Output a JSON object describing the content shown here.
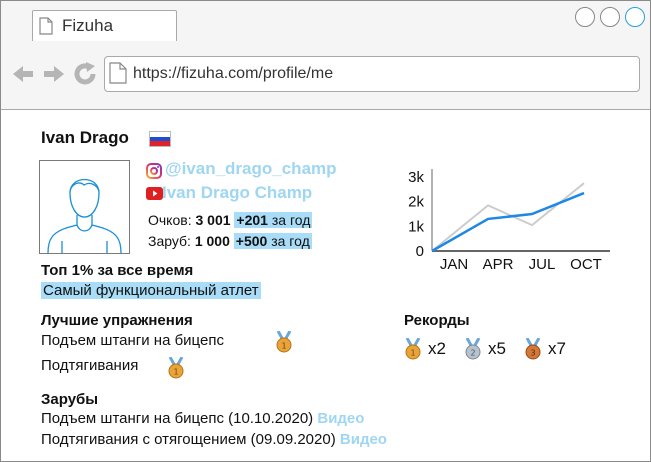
{
  "browser": {
    "tab_title": "Fizuha",
    "url": "https://fizuha.com/profile/me"
  },
  "profile": {
    "name": "Ivan Drago",
    "country_flag": "russia-flag-icon",
    "instagram": "@ivan_drago_champ",
    "youtube": "Ivan Drago Champ",
    "points_label": "Очков:",
    "points_value": "3 001",
    "points_delta": "+201",
    "points_period": "за год",
    "lifts_label": "Заруб:",
    "lifts_value": "1 000",
    "lifts_delta": "+500",
    "lifts_period": "за год",
    "rank_title": "Топ 1% за все время",
    "rank_badge": "Самый функциональный атлет"
  },
  "best_exercises": {
    "title": "Лучшие упражнения",
    "items": [
      {
        "label": "Подъем штанги на бицепс",
        "medal": "gold"
      },
      {
        "label": "Подтягивания",
        "medal": "gold"
      }
    ]
  },
  "records": {
    "title": "Рекорды",
    "items": [
      {
        "medal": "gold",
        "count": "x2"
      },
      {
        "medal": "silver",
        "count": "x5"
      },
      {
        "medal": "bronze",
        "count": "x7"
      }
    ]
  },
  "lifts_log": {
    "title": "Зарубы",
    "items": [
      {
        "text": "Подъем штанги на бицепс (10.10.2020)",
        "link": "Видео"
      },
      {
        "text": "Подтягивания с отягощением (09.09.2020)",
        "link": "Видео"
      }
    ]
  },
  "colors": {
    "accent": "#1e88e5",
    "highlight": "#a8dcf7",
    "link": "#9fd6f2",
    "gold": "#e8a33a",
    "silver": "#b8c2cc",
    "bronze": "#d2783a"
  },
  "chart_data": {
    "type": "line",
    "categories": [
      "JAN",
      "APR",
      "JUL",
      "OCT"
    ],
    "ytick_labels": [
      "0",
      "1k",
      "2k",
      "3k"
    ],
    "ylim": [
      0,
      3000
    ],
    "series": [
      {
        "values": [
          0,
          1300,
          1500,
          2350
        ],
        "color": "#1e88e5"
      },
      {
        "values": [
          0,
          1850,
          1050,
          2750
        ],
        "color": "#cccccc"
      }
    ]
  }
}
